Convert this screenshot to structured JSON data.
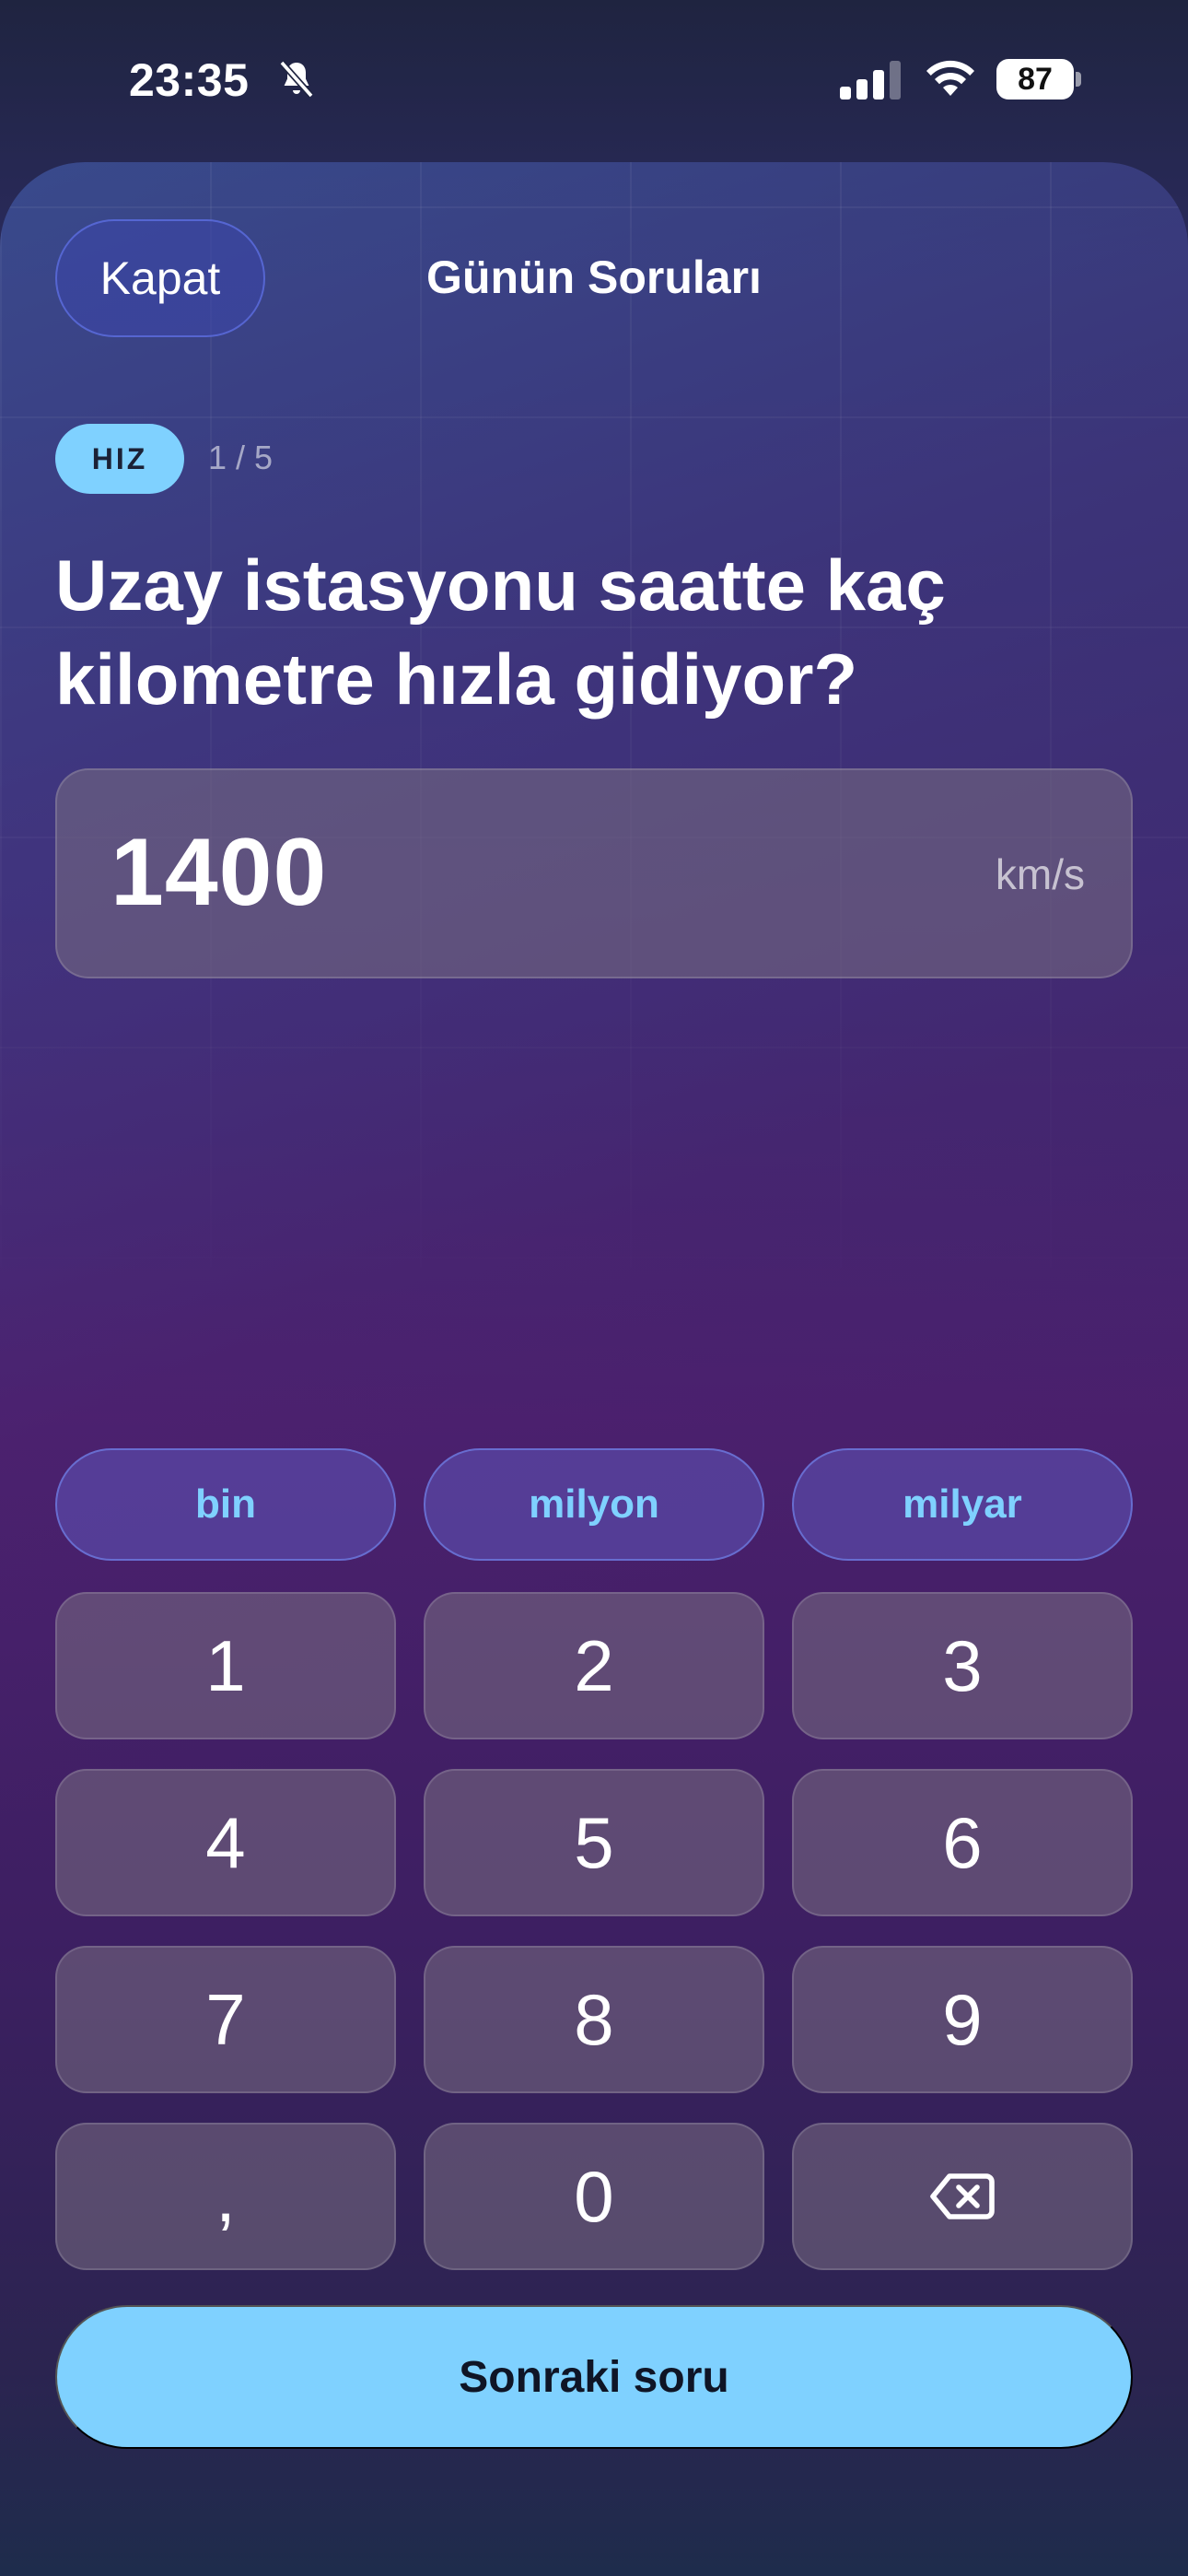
{
  "status_bar": {
    "time": "23:35",
    "battery": "87"
  },
  "header": {
    "close_label": "Kapat",
    "title": "Günün Soruları"
  },
  "question": {
    "tag": "HIZ",
    "progress": "1 / 5",
    "text": "Uzay istasyonu saatte kaç kilometre hızla gidiyor?"
  },
  "answer": {
    "value": "1400",
    "unit": "km/s"
  },
  "keypad": {
    "suffixes": [
      "bin",
      "milyon",
      "milyar"
    ],
    "keys": [
      "1",
      "2",
      "3",
      "4",
      "5",
      "6",
      "7",
      "8",
      "9",
      ",",
      "0"
    ]
  },
  "footer": {
    "next_label": "Sonraki soru"
  },
  "colors": {
    "accent": "#7fd1ff",
    "key_bg": "#6e6680"
  },
  "icons": [
    "bell-slash-icon",
    "signal-icon",
    "wifi-icon",
    "battery-icon",
    "backspace-icon"
  ]
}
